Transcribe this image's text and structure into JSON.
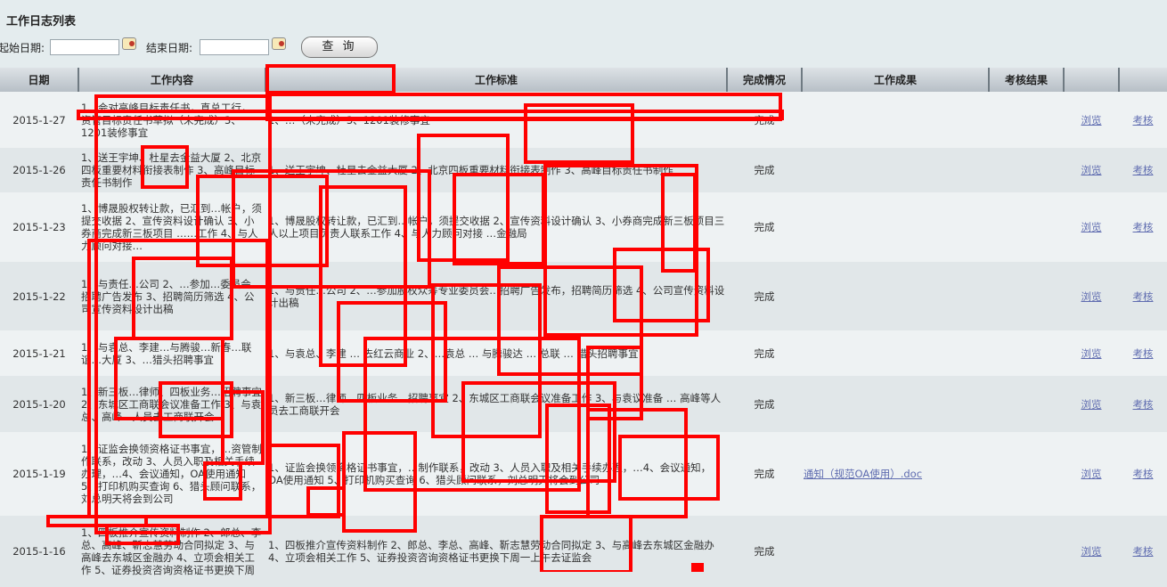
{
  "page": {
    "title": "工作日志列表",
    "start_label": "起始日期:",
    "end_label": "结束日期:",
    "start_value": "",
    "end_value": "",
    "query_label": "查 询"
  },
  "columns": [
    "日期",
    "工作内容",
    "工作标准",
    "完成情况",
    "工作成果",
    "考核结果",
    "",
    ""
  ],
  "rows": [
    {
      "date": "2015-1-27",
      "content": "1、会对高峰目标责任书，真总工行，…资管目标责任书草拟（未完成）3、1201装修事宜",
      "standard": "1、…（未完成）3、1201装修事宜",
      "status": "完成",
      "result": "",
      "view": "浏览",
      "assess": "考核"
    },
    {
      "date": "2015-1-26",
      "content": "1、送王宇坤、杜星去金益大厦 2、北京四板重要材料衔接表制作 3、高峰目标责任书制作",
      "standard": "1、送王宇坤、杜星去金益大厦 2、北京四板重要材料衔接表制作 3、高峰目标责任书制作",
      "status": "完成",
      "result": "",
      "view": "浏览",
      "assess": "考核"
    },
    {
      "date": "2015-1-23",
      "content": "1、博晟股权转让款，已汇到…帐户，须提交收据 2、宣传资料设计确认 3、小券商完成新三板项目 ……工作 4、与人力顾问对接…",
      "standard": "1、博晟股权转让款，已汇到…帐户，须提交收据 2、宣传资料设计确认 3、小券商完成新三板项目三人以上项目负责人联系工作 4、与人力顾问对接 …金融局",
      "status": "完成",
      "result": "",
      "view": "浏览",
      "assess": "考核"
    },
    {
      "date": "2015-1-22",
      "content": "1、与责任…公司 2、…参加…委员会…招聘广告发布 3、招聘简历筛选 4、公司宣传资料设计出稿",
      "standard": "1、与责任…公司 2、…参加股权众筹专业委员会…招聘广告发布，招聘简历筛选 4、公司宣传资料设计出稿",
      "status": "完成",
      "result": "",
      "view": "浏览",
      "assess": "考核"
    },
    {
      "date": "2015-1-21",
      "content": "1、与袁总、李建…与腾骏…新春…联谊…大厦 3、…猎头招聘事宜",
      "standard": "1、与袁总、李建 … 去红云商业 2、…袁总 … 与腾骏达 … 总联 … 猎头招聘事宜",
      "status": "完成",
      "result": "",
      "view": "浏览",
      "assess": "考核"
    },
    {
      "date": "2015-1-20",
      "content": "1、新三板…律师、四板业务…招聘事宜 2、东城区工商联会议准备工作 3、与袁总、高峰…人员去工商联开会",
      "standard": "1、新三板…律师、四板业务…招聘事宜 2、东城区工商联会议准备工作 3、与袁议准备 … 高峰等人员去工商联开会",
      "status": "完成",
      "result": "",
      "view": "浏览",
      "assess": "考核"
    },
    {
      "date": "2015-1-19",
      "content": "1、证监会换领资格证书事宜，…资管制作联系，改动 3、人员入职及相关手续办理，…4、会议通知，OA使用通知 5、打印机购买查询 6、猎头顾问联系，刘总明天将会到公司",
      "standard": "1、证监会换领资格证书事宜，…制作联系，改动 3、人员入职及相关手续办理，…4、会议通知，OA使用通知 5、打印机购买查询 6、猎头顾问联系，刘总明天将会到公司",
      "status": "完成",
      "result": "通知（规范OA使用）.doc",
      "view": "浏览",
      "assess": "考核"
    },
    {
      "date": "2015-1-16",
      "content": "1、四板推介宣传资料制作 2、郎总、李总、高峰、靳志慧劳动合同拟定 3、与高峰去东城区金融办 4、立项会相关工作 5、证券投资咨询资格证书更换下周一上午去证监会",
      "standard": "1、四板推介宣传资料制作 2、郎总、李总、高峰、靳志慧劳动合同拟定 3、与高峰去东城区金融办 4、立项会相关工作 5、证券投资咨询资格证书更换下周一上午去证监会",
      "status": "完成",
      "result": "",
      "view": "浏览",
      "assess": "考核"
    }
  ]
}
